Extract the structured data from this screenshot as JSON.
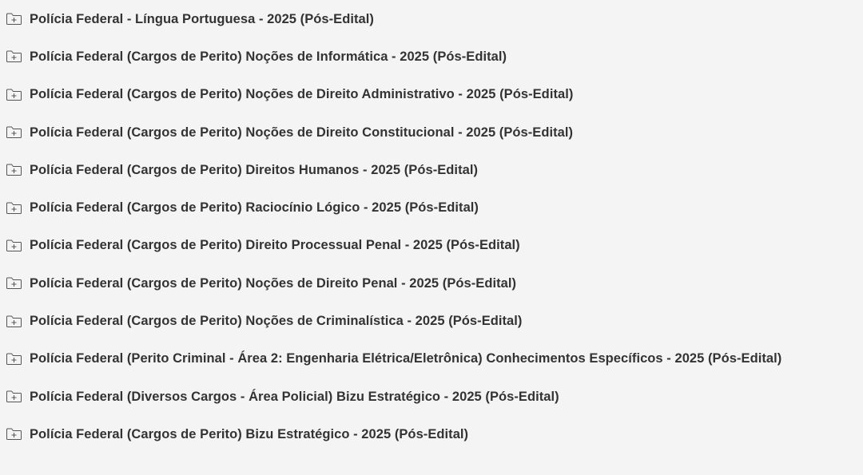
{
  "page": {
    "background": "#f4f4f4",
    "text_color": "#333333",
    "icon_color": "#555555"
  },
  "folders": [
    {
      "title": "Polícia Federal - Língua Portuguesa - 2025 (Pós-Edital)",
      "icon": "folder-plus-icon"
    },
    {
      "title": "Polícia Federal (Cargos de Perito) Noções de Informática - 2025 (Pós-Edital)",
      "icon": "folder-plus-icon"
    },
    {
      "title": "Polícia Federal (Cargos de Perito) Noções de Direito Administrativo - 2025 (Pós-Edital)",
      "icon": "folder-plus-icon"
    },
    {
      "title": "Polícia Federal (Cargos de Perito) Noções de Direito Constitucional - 2025 (Pós-Edital)",
      "icon": "folder-plus-icon"
    },
    {
      "title": "Polícia Federal (Cargos de Perito) Direitos Humanos - 2025 (Pós-Edital)",
      "icon": "folder-plus-icon"
    },
    {
      "title": "Polícia Federal (Cargos de Perito) Raciocínio Lógico - 2025 (Pós-Edital)",
      "icon": "folder-plus-icon"
    },
    {
      "title": "Polícia Federal (Cargos de Perito) Direito Processual Penal - 2025 (Pós-Edital)",
      "icon": "folder-plus-icon"
    },
    {
      "title": "Polícia Federal (Cargos de Perito) Noções de Direito Penal - 2025 (Pós-Edital)",
      "icon": "folder-plus-icon"
    },
    {
      "title": "Polícia Federal (Cargos de Perito) Noções de Criminalística - 2025 (Pós-Edital)",
      "icon": "folder-plus-icon"
    },
    {
      "title": "Polícia Federal (Perito Criminal - Área 2: Engenharia Elétrica/Eletrônica) Conhecimentos Específicos - 2025 (Pós-Edital)",
      "icon": "folder-plus-icon"
    },
    {
      "title": "Polícia Federal (Diversos Cargos - Área Policial) Bizu Estratégico - 2025 (Pós-Edital)",
      "icon": "folder-plus-icon"
    },
    {
      "title": "Polícia Federal (Cargos de Perito) Bizu Estratégico - 2025 (Pós-Edital)",
      "icon": "folder-plus-icon"
    }
  ]
}
